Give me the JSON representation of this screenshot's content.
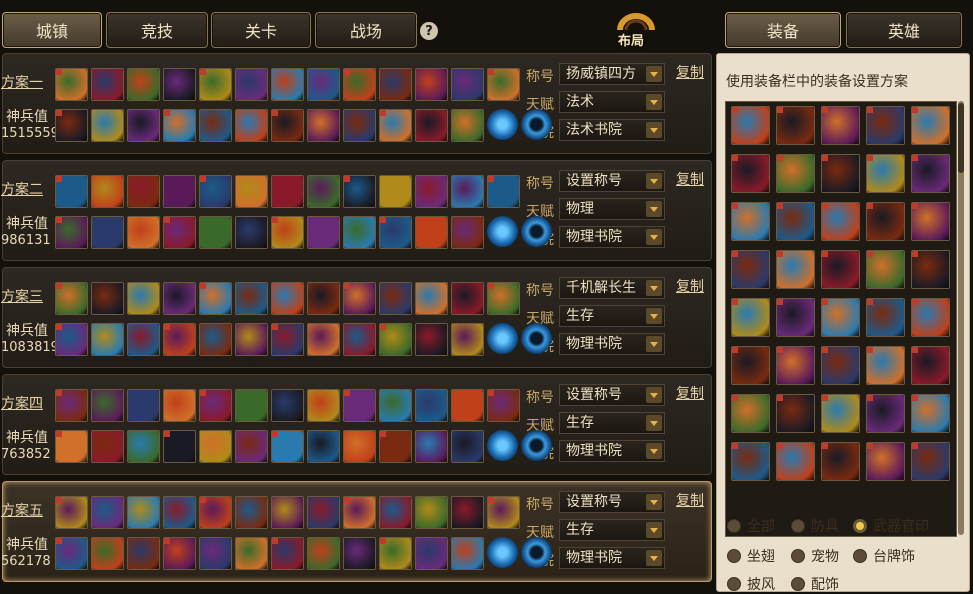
{
  "top_tabs": [
    "城镇",
    "竞技",
    "关卡",
    "战场"
  ],
  "help_label": "?",
  "layout_logo": "布局",
  "right_tabs": [
    "装备",
    "英雄"
  ],
  "plans": [
    {
      "name": "方案一",
      "power_label": "神兵值",
      "power": "1515559",
      "title_label": "称号",
      "title": "扬威镇四方",
      "talent_label": "天赋",
      "talent": "法术",
      "academy_label": "书院",
      "academy": "法术书院",
      "copy": "复制"
    },
    {
      "name": "方案二",
      "power_label": "神兵值",
      "power": "986131",
      "title_label": "称号",
      "title": "设置称号",
      "talent_label": "天赋",
      "talent": "物理",
      "academy_label": "书院",
      "academy": "物理书院",
      "copy": "复制"
    },
    {
      "name": "方案三",
      "power_label": "神兵值",
      "power": "1083819",
      "title_label": "称号",
      "title": "千机解长生",
      "talent_label": "天赋",
      "talent": "生存",
      "academy_label": "书院",
      "academy": "物理书院",
      "copy": "复制"
    },
    {
      "name": "方案四",
      "power_label": "神兵值",
      "power": "763852",
      "title_label": "称号",
      "title": "设置称号",
      "talent_label": "天赋",
      "talent": "生存",
      "academy_label": "书院",
      "academy": "物理书院",
      "copy": "复制"
    },
    {
      "name": "方案五",
      "power_label": "神兵值",
      "power": "562178",
      "title_label": "称号",
      "title": "设置称号",
      "talent_label": "天赋",
      "talent": "生存",
      "academy_label": "书院",
      "academy": "物理书院",
      "copy": "复制"
    }
  ],
  "panel": {
    "title": "使用装备栏中的装备设置方案",
    "filters": [
      {
        "label": "全部",
        "selected": false
      },
      {
        "label": "防具",
        "selected": false
      },
      {
        "label": "武器官印",
        "selected": true
      },
      {
        "label": "坐翅",
        "selected": false
      },
      {
        "label": "宠物",
        "selected": false
      },
      {
        "label": "台牌饰",
        "selected": false
      },
      {
        "label": "披风",
        "selected": false
      },
      {
        "label": "配饰",
        "selected": false
      }
    ]
  },
  "colors": {
    "accent": "#c9a768",
    "panel_bg": "#e9dfcb",
    "dark_bg": "#14100c"
  }
}
